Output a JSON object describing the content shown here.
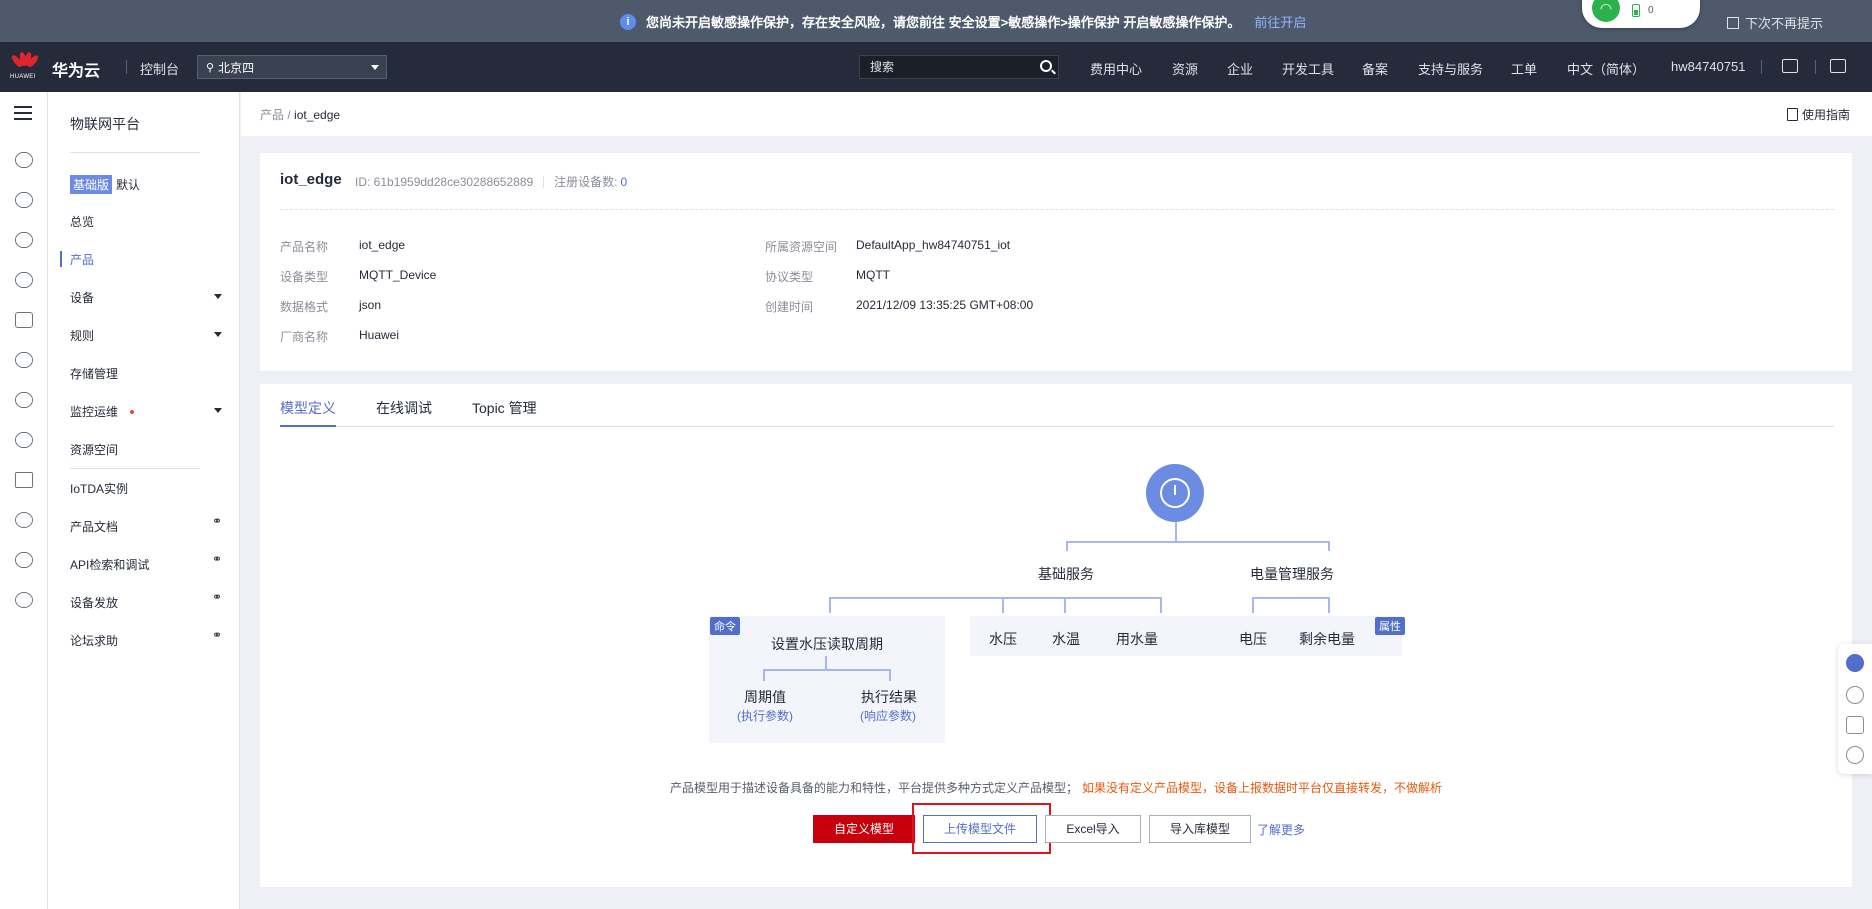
{
  "notice": {
    "info_glyph": "i",
    "message": "您尚未开启敏感操作保护，存在安全风险，请您前往 安全设置>敏感操作>操作保护 开启敏感操作保护。",
    "link": "前往开启",
    "dont_show": "下次不再提示",
    "wifi_count": "0"
  },
  "topbar": {
    "logo_text": "HUAWEI",
    "brand": "华为云",
    "console": "控制台",
    "region": "北京四",
    "search_placeholder": "搜索",
    "nav": [
      "费用中心",
      "资源",
      "企业",
      "开发工具",
      "备案",
      "支持与服务",
      "工单",
      "中文（简体）",
      "hw84740751"
    ]
  },
  "sidebar": {
    "title": "物联网平台",
    "edition_badge": "基础版",
    "edition_default": "默认",
    "items": [
      "总览",
      "产品",
      "设备",
      "规则",
      "存储管理",
      "监控运维",
      "资源空间",
      "IoTDA实例",
      "产品文档",
      "API检索和调试",
      "设备发放",
      "论坛求助"
    ],
    "active": "产品"
  },
  "breadcrumb": {
    "parent": "产品",
    "current": "iot_edge",
    "guide": "使用指南"
  },
  "product": {
    "name_title": "iot_edge",
    "id_label": "ID: 61b1959dd28ce30288652889",
    "registered_label": "注册设备数:",
    "registered_count": "0",
    "fields_left": [
      {
        "k": "产品名称",
        "v": "iot_edge"
      },
      {
        "k": "设备类型",
        "v": "MQTT_Device"
      },
      {
        "k": "数据格式",
        "v": "json"
      },
      {
        "k": "厂商名称",
        "v": "Huawei"
      }
    ],
    "fields_right": [
      {
        "k": "所属资源空间",
        "v": "DefaultApp_hw84740751_iot"
      },
      {
        "k": "协议类型",
        "v": "MQTT"
      },
      {
        "k": "创建时间",
        "v": "2021/12/09 13:35:25 GMT+08:00"
      }
    ]
  },
  "tabs": [
    "模型定义",
    "在线调试",
    "Topic 管理"
  ],
  "model": {
    "service1": "基础服务",
    "service2": "电量管理服务",
    "command_tag": "命令",
    "property_tag": "属性",
    "command": "设置水压读取周期",
    "cmd_param1": "周期值",
    "cmd_param1_sub": "(执行参数)",
    "cmd_param2": "执行结果",
    "cmd_param2_sub": "(响应参数)",
    "props1": [
      "水压",
      "水温",
      "用水量"
    ],
    "props2": [
      "电压",
      "剩余电量"
    ]
  },
  "description": {
    "text": "产品模型用于描述设备具备的能力和特性，平台提供多种方式定义产品模型；",
    "warning": "如果没有定义产品模型，设备上报数据时平台仅直接转发，不做解析"
  },
  "actions": {
    "custom": "自定义模型",
    "upload": "上传模型文件",
    "excel": "Excel导入",
    "library": "导入库模型",
    "more": "了解更多"
  },
  "colors": {
    "accent": "#526ecc",
    "brand_red": "#c7000b",
    "header": "#252b3a",
    "highlight": "#e0141e"
  }
}
